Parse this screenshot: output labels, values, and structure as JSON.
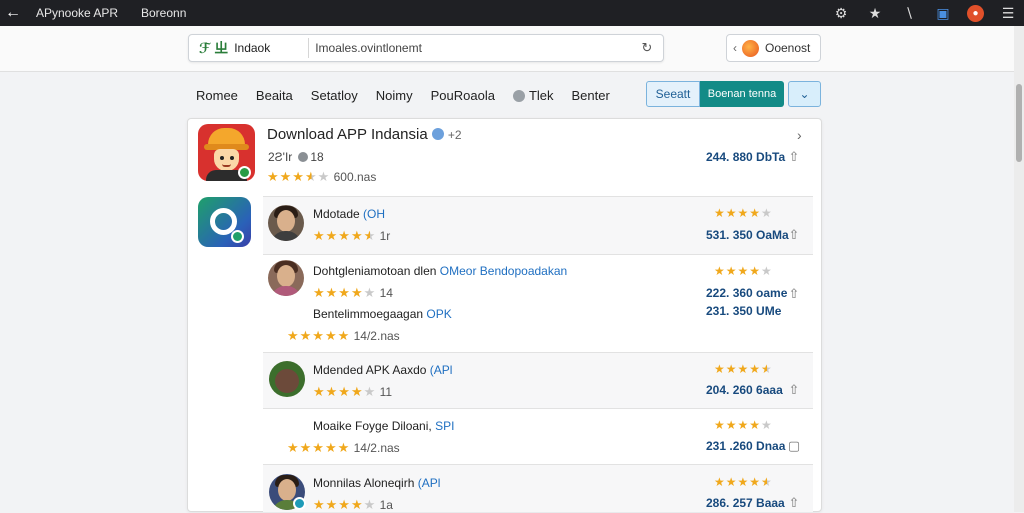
{
  "browser": {
    "tab_title": "APynooke APR",
    "tab_title2": "Boreonn"
  },
  "address_bar": {
    "logo_text": "ℱ ㄓ",
    "site_name": "Indaok",
    "url": "Imoales.ovintlonemt",
    "account_label": "Ooenost"
  },
  "nav": {
    "items": [
      "Romee",
      "Beaita",
      "Setatloy",
      "Noimy",
      "PouRoaola",
      "Tlek",
      "Benter"
    ],
    "search_label": "Seeatt",
    "download_label": "Boenan tenna"
  },
  "app": {
    "title": "Download APP Indansia",
    "version": "+2",
    "sub_left": "2Ƨ'Ir",
    "sub_right": "18",
    "rating_text": "600.nas",
    "size": "244. 880 DbTa",
    "rating_value": 3.5
  },
  "rows": [
    {
      "name": "Mdotade",
      "tag": "(OH",
      "stars_count": "1r",
      "rating_value": 4.5,
      "size": "531. 350 OaMa",
      "star_rating": 4
    },
    {
      "name": "Dohtgleniamotoan dlen",
      "tag": "OMeor Bendopoadakan",
      "stars_count": "14",
      "rating_value": 4,
      "size": "222. 360 oame",
      "star_rating": 4
    },
    {
      "name": "Bentelimmoegaagan",
      "tag": "OPK",
      "stars_count": "14/2.nas",
      "rating_value": 5,
      "size": "231. 350 UMe",
      "star_rating": 0
    },
    {
      "name": "Mdended APK Aaxdo",
      "tag": "(APl",
      "stars_count": "11",
      "rating_value": 4,
      "size": "204. 260 6aaa",
      "star_rating": 4.5
    },
    {
      "name": "Moaike Foyge Diloani,",
      "tag": "SPI",
      "stars_count": "14/2.nas",
      "rating_value": 5,
      "size": "231 .260 Dnaa",
      "star_rating": 4
    },
    {
      "name": "Monnilas Aloneqirh",
      "tag": "(APl",
      "stars_count": "1a",
      "rating_value": 4,
      "size": "286. 257 Baaa",
      "star_rating": 4.5
    }
  ],
  "colors": {
    "accent_teal": "#138b87",
    "star": "#f0a81c",
    "link_blue": "#1f6fc1",
    "size_blue": "#184a7e"
  }
}
